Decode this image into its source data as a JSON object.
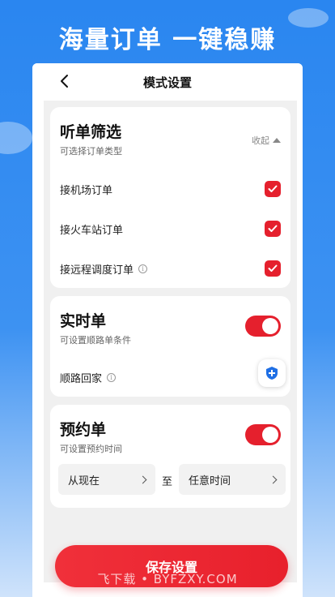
{
  "banner": {
    "title": "海量订单 一键稳赚"
  },
  "nav": {
    "title": "模式设置"
  },
  "filter_card": {
    "title": "听单筛选",
    "subtitle": "可选择订单类型",
    "collapse_label": "收起",
    "options": [
      {
        "label": "接机场订单",
        "checked": true
      },
      {
        "label": "接火车站订单",
        "checked": true
      },
      {
        "label": "接远程调度订单",
        "checked": true,
        "info": "i"
      }
    ]
  },
  "realtime_card": {
    "title": "实时单",
    "subtitle": "可设置顺路单条件",
    "toggle_on": true,
    "route_home_label": "顺路回家",
    "info": "i"
  },
  "reserve_card": {
    "title": "预约单",
    "subtitle": "可设置预约时间",
    "toggle_on": true,
    "from_label": "从现在",
    "to_separator": "至",
    "to_label": "任意时间"
  },
  "save_button": "保存设置",
  "watermark": "飞下载 • BYFZXY.COM",
  "colors": {
    "accent": "#e5202d",
    "background": "#2a86f0",
    "shield": "#1f6fe5"
  }
}
